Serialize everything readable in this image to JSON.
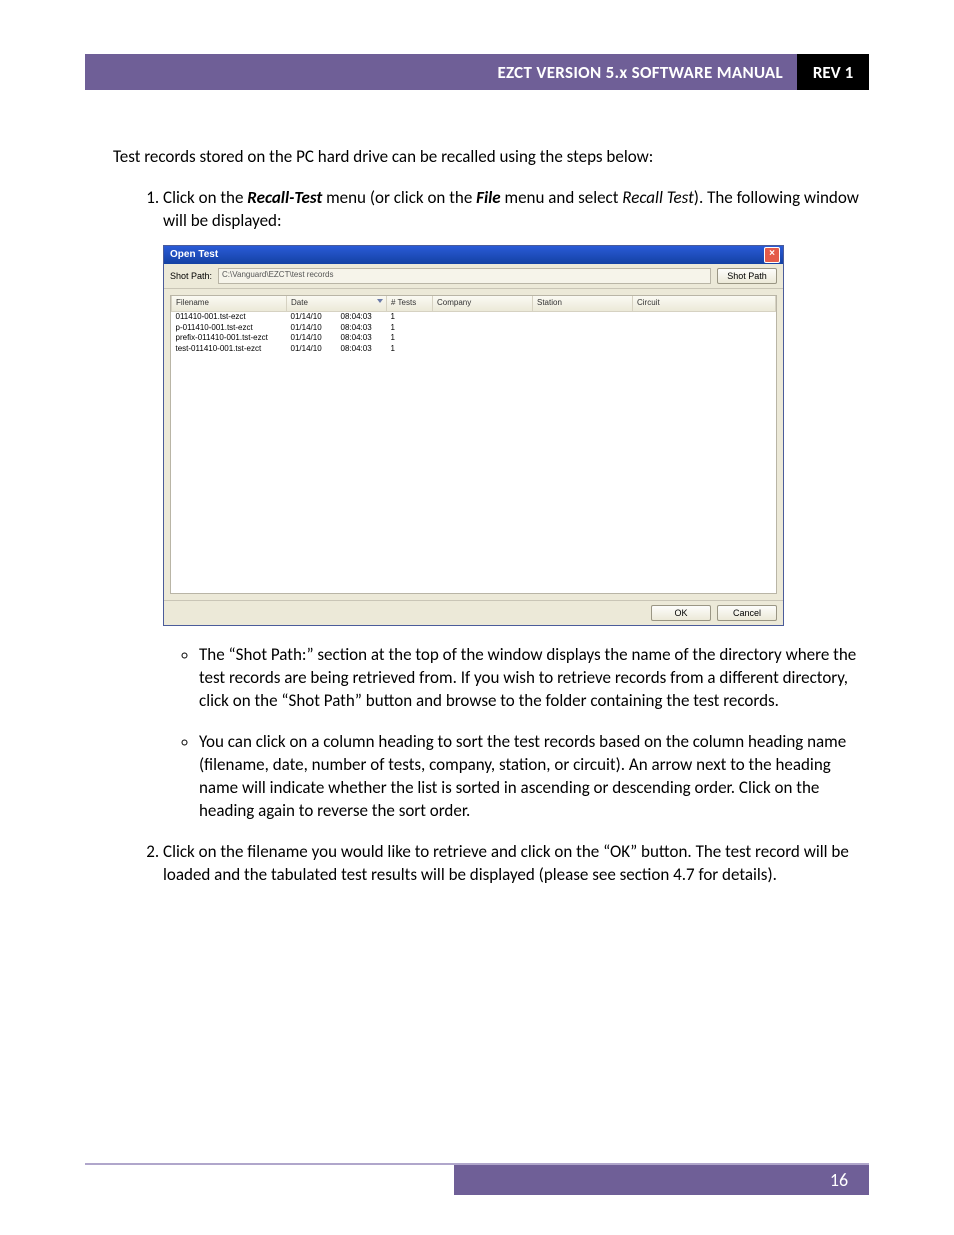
{
  "header": {
    "title": "EZCT VERSION 5.x SOFTWARE MANUAL",
    "rev": "REV 1"
  },
  "intro": "Test records stored on the PC hard drive can be recalled using the steps below:",
  "step1": {
    "pre": "Click on the ",
    "b1": "Recall-Test",
    "mid1": " menu (or click on the ",
    "b2": "File",
    "mid2": " menu and select ",
    "i1": "Recall Test",
    "post": "). The following window will be displayed:"
  },
  "dialog": {
    "title": "Open Test",
    "shot_path_label": "Shot Path:",
    "shot_path_value": "C:\\Vanguard\\EZCT\\test records",
    "shot_path_btn": "Shot Path",
    "ok": "OK",
    "cancel": "Cancel",
    "cols": [
      "Filename",
      "Date",
      "",
      "# Tests",
      "Company",
      "Station",
      "Circuit"
    ],
    "rows": [
      [
        "011410-001.tst-ezct",
        "01/14/10",
        "08:04:03",
        "1",
        "",
        "",
        ""
      ],
      [
        "p-011410-001.tst-ezct",
        "01/14/10",
        "08:04:03",
        "1",
        "",
        "",
        ""
      ],
      [
        "prefix-011410-001.tst-ezct",
        "01/14/10",
        "08:04:03",
        "1",
        "",
        "",
        ""
      ],
      [
        "test-011410-001.tst-ezct",
        "01/14/10",
        "08:04:03",
        "1",
        "",
        "",
        ""
      ]
    ]
  },
  "bullets": [
    "The “Shot Path:” section at the top of the window displays the name of the directory where the test records are being retrieved from. If you wish to retrieve records from a different directory, click on the “Shot Path” button and browse to the folder containing the test records.",
    "You can click on a column heading to sort the test records based on the column heading name (filename, date, number of tests, company, station, or circuit). An arrow next to the heading name will indicate whether the list is sorted in ascending or descending order. Click on the heading again to reverse the sort order."
  ],
  "step2": "Click on the filename you would like to retrieve and click on the “OK” button. The test record will be loaded and the tabulated test results will be displayed (please see section 4.7 for details).",
  "page_number": "16"
}
